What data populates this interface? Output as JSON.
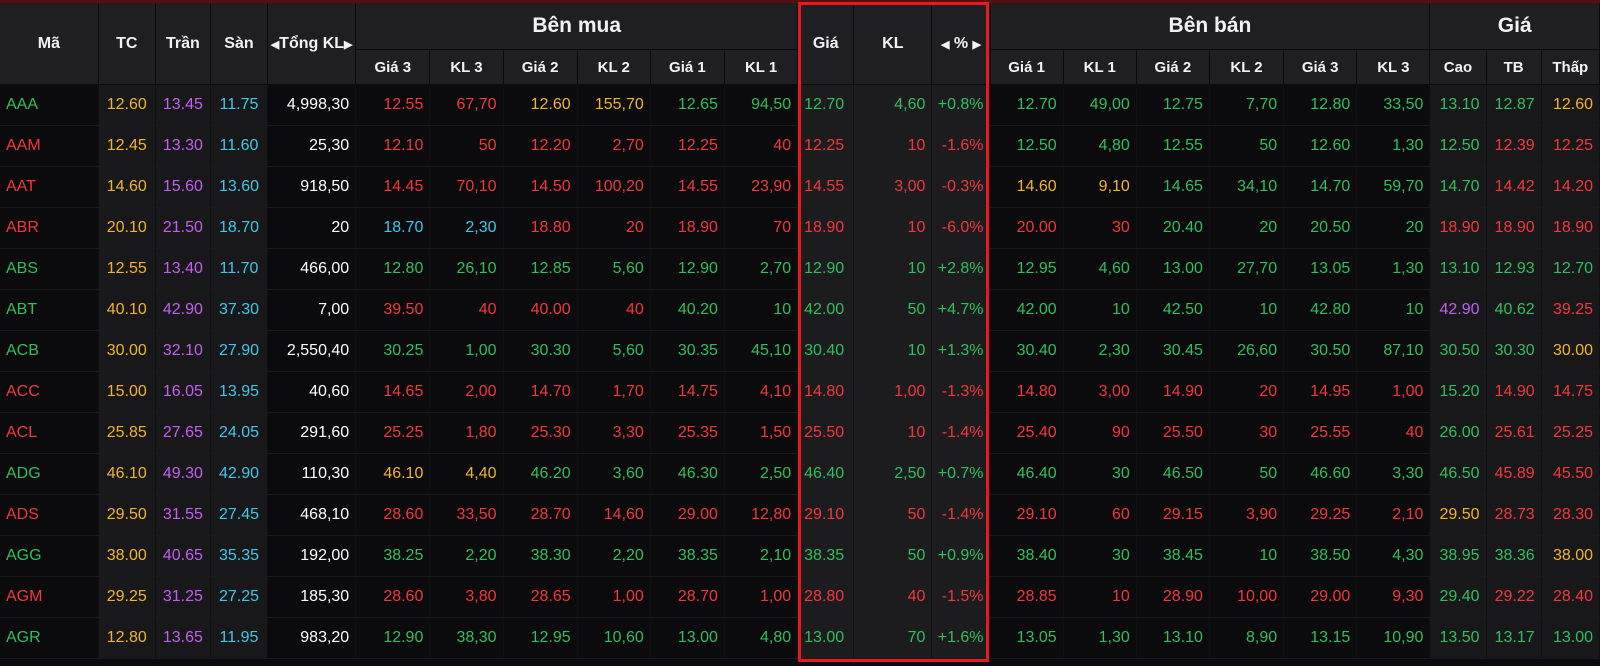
{
  "headers": {
    "symbol": "Mã",
    "ref": "TC",
    "ceiling": "Trần",
    "floor": "Sàn",
    "total_vol": "Tổng KL",
    "buy_side": "Bên mua",
    "buy_cols": [
      "Giá 3",
      "KL 3",
      "Giá 2",
      "KL 2",
      "Giá 1",
      "KL 1"
    ],
    "match_price": "Giá",
    "match_vol": "KL",
    "match_pct": "%",
    "sell_side": "Bên bán",
    "sell_cols": [
      "Giá 1",
      "KL 1",
      "Giá 2",
      "KL 2",
      "Giá 3",
      "KL 3"
    ],
    "price_group": "Giá",
    "price_cols": [
      "Cao",
      "TB",
      "Thấp"
    ]
  },
  "colors": {
    "green": "#2fbf5b",
    "red": "#f2373a",
    "yellow": "#f0b429",
    "purple": "#c45ef0",
    "cyan": "#3ec8e8",
    "highlight": "#e51a1f"
  },
  "rows": [
    {
      "s": "AAA",
      "tc": "12.60",
      "tr": "13.45",
      "sa": "11.75",
      "tkl": "4,998,30",
      "b3": "12.55",
      "bk3": "67,70",
      "b2": "12.60",
      "bk2": "155,70",
      "b1": "12.65",
      "bk1": "94,50",
      "mp": "12.70",
      "mv": "4,60",
      "pc": "+0.8%",
      "s1": "12.70",
      "sk1": "49,00",
      "s2": "12.75",
      "sk2": "7,70",
      "s3": "12.80",
      "sk3": "33,50",
      "hi": "13.10",
      "avg": "12.87",
      "lo": "12.60",
      "c": {
        "s": "green",
        "b3": "red",
        "b2": "yellow",
        "b1": "green",
        "m": "green",
        "s1": "green",
        "s2": "green",
        "s3": "green",
        "hi": "green",
        "avg": "green",
        "lo": "yellow"
      }
    },
    {
      "s": "AAM",
      "tc": "12.45",
      "tr": "13.30",
      "sa": "11.60",
      "tkl": "25,30",
      "b3": "12.10",
      "bk3": "50",
      "b2": "12.20",
      "bk2": "2,70",
      "b1": "12.25",
      "bk1": "40",
      "mp": "12.25",
      "mv": "10",
      "pc": "-1.6%",
      "s1": "12.50",
      "sk1": "4,80",
      "s2": "12.55",
      "sk2": "50",
      "s3": "12.60",
      "sk3": "1,30",
      "hi": "12.50",
      "avg": "12.39",
      "lo": "12.25",
      "c": {
        "s": "red",
        "b3": "red",
        "b2": "red",
        "b1": "red",
        "m": "red",
        "s1": "green",
        "s2": "green",
        "s3": "green",
        "hi": "green",
        "avg": "red",
        "lo": "red"
      }
    },
    {
      "s": "AAT",
      "tc": "14.60",
      "tr": "15.60",
      "sa": "13.60",
      "tkl": "918,50",
      "b3": "14.45",
      "bk3": "70,10",
      "b2": "14.50",
      "bk2": "100,20",
      "b1": "14.55",
      "bk1": "23,90",
      "mp": "14.55",
      "mv": "3,00",
      "pc": "-0.3%",
      "s1": "14.60",
      "sk1": "9,10",
      "s2": "14.65",
      "sk2": "34,10",
      "s3": "14.70",
      "sk3": "59,70",
      "hi": "14.70",
      "avg": "14.42",
      "lo": "14.20",
      "c": {
        "s": "red",
        "b3": "red",
        "b2": "red",
        "b1": "red",
        "m": "red",
        "s1": "yellow",
        "s2": "green",
        "s3": "green",
        "hi": "green",
        "avg": "red",
        "lo": "red"
      }
    },
    {
      "s": "ABR",
      "tc": "20.10",
      "tr": "21.50",
      "sa": "18.70",
      "tkl": "20",
      "b3": "18.70",
      "bk3": "2,30",
      "b2": "18.80",
      "bk2": "20",
      "b1": "18.90",
      "bk1": "70",
      "mp": "18.90",
      "mv": "10",
      "pc": "-6.0%",
      "s1": "20.00",
      "sk1": "30",
      "s2": "20.40",
      "sk2": "20",
      "s3": "20.50",
      "sk3": "20",
      "hi": "18.90",
      "avg": "18.90",
      "lo": "18.90",
      "c": {
        "s": "red",
        "b3": "cyan",
        "b2": "red",
        "b1": "red",
        "m": "red",
        "s1": "red",
        "s2": "green",
        "s3": "green",
        "hi": "red",
        "avg": "red",
        "lo": "red"
      }
    },
    {
      "s": "ABS",
      "tc": "12.55",
      "tr": "13.40",
      "sa": "11.70",
      "tkl": "466,00",
      "b3": "12.80",
      "bk3": "26,10",
      "b2": "12.85",
      "bk2": "5,60",
      "b1": "12.90",
      "bk1": "2,70",
      "mp": "12.90",
      "mv": "10",
      "pc": "+2.8%",
      "s1": "12.95",
      "sk1": "4,60",
      "s2": "13.00",
      "sk2": "27,70",
      "s3": "13.05",
      "sk3": "1,30",
      "hi": "13.10",
      "avg": "12.93",
      "lo": "12.70",
      "c": {
        "s": "green",
        "b3": "green",
        "b2": "green",
        "b1": "green",
        "m": "green",
        "s1": "green",
        "s2": "green",
        "s3": "green",
        "hi": "green",
        "avg": "green",
        "lo": "green"
      }
    },
    {
      "s": "ABT",
      "tc": "40.10",
      "tr": "42.90",
      "sa": "37.30",
      "tkl": "7,00",
      "b3": "39.50",
      "bk3": "40",
      "b2": "40.00",
      "bk2": "40",
      "b1": "40.20",
      "bk1": "10",
      "mp": "42.00",
      "mv": "50",
      "pc": "+4.7%",
      "s1": "42.00",
      "sk1": "10",
      "s2": "42.50",
      "sk2": "10",
      "s3": "42.80",
      "sk3": "10",
      "hi": "42.90",
      "avg": "40.62",
      "lo": "39.25",
      "c": {
        "s": "green",
        "b3": "red",
        "b2": "red",
        "b1": "green",
        "m": "green",
        "s1": "green",
        "s2": "green",
        "s3": "green",
        "hi": "purple",
        "avg": "green",
        "lo": "red"
      }
    },
    {
      "s": "ACB",
      "tc": "30.00",
      "tr": "32.10",
      "sa": "27.90",
      "tkl": "2,550,40",
      "b3": "30.25",
      "bk3": "1,00",
      "b2": "30.30",
      "bk2": "5,60",
      "b1": "30.35",
      "bk1": "45,10",
      "mp": "30.40",
      "mv": "10",
      "pc": "+1.3%",
      "s1": "30.40",
      "sk1": "2,30",
      "s2": "30.45",
      "sk2": "26,60",
      "s3": "30.50",
      "sk3": "87,10",
      "hi": "30.50",
      "avg": "30.30",
      "lo": "30.00",
      "c": {
        "s": "green",
        "b3": "green",
        "b2": "green",
        "b1": "green",
        "m": "green",
        "s1": "green",
        "s2": "green",
        "s3": "green",
        "hi": "green",
        "avg": "green",
        "lo": "yellow"
      }
    },
    {
      "s": "ACC",
      "tc": "15.00",
      "tr": "16.05",
      "sa": "13.95",
      "tkl": "40,60",
      "b3": "14.65",
      "bk3": "2,00",
      "b2": "14.70",
      "bk2": "1,70",
      "b1": "14.75",
      "bk1": "4,10",
      "mp": "14.80",
      "mv": "1,00",
      "pc": "-1.3%",
      "s1": "14.80",
      "sk1": "3,00",
      "s2": "14.90",
      "sk2": "20",
      "s3": "14.95",
      "sk3": "1,00",
      "hi": "15.20",
      "avg": "14.90",
      "lo": "14.75",
      "c": {
        "s": "red",
        "b3": "red",
        "b2": "red",
        "b1": "red",
        "m": "red",
        "s1": "red",
        "s2": "red",
        "s3": "red",
        "hi": "green",
        "avg": "red",
        "lo": "red"
      }
    },
    {
      "s": "ACL",
      "tc": "25.85",
      "tr": "27.65",
      "sa": "24.05",
      "tkl": "291,60",
      "b3": "25.25",
      "bk3": "1,80",
      "b2": "25.30",
      "bk2": "3,30",
      "b1": "25.35",
      "bk1": "1,50",
      "mp": "25.50",
      "mv": "10",
      "pc": "-1.4%",
      "s1": "25.40",
      "sk1": "90",
      "s2": "25.50",
      "sk2": "30",
      "s3": "25.55",
      "sk3": "40",
      "hi": "26.00",
      "avg": "25.61",
      "lo": "25.25",
      "c": {
        "s": "red",
        "b3": "red",
        "b2": "red",
        "b1": "red",
        "m": "red",
        "s1": "red",
        "s2": "red",
        "s3": "red",
        "hi": "green",
        "avg": "red",
        "lo": "red"
      }
    },
    {
      "s": "ADG",
      "tc": "46.10",
      "tr": "49.30",
      "sa": "42.90",
      "tkl": "110,30",
      "b3": "46.10",
      "bk3": "4,40",
      "b2": "46.20",
      "bk2": "3,60",
      "b1": "46.30",
      "bk1": "2,50",
      "mp": "46.40",
      "mv": "2,50",
      "pc": "+0.7%",
      "s1": "46.40",
      "sk1": "30",
      "s2": "46.50",
      "sk2": "50",
      "s3": "46.60",
      "sk3": "3,30",
      "hi": "46.50",
      "avg": "45.89",
      "lo": "45.50",
      "c": {
        "s": "green",
        "b3": "yellow",
        "b2": "green",
        "b1": "green",
        "m": "green",
        "s1": "green",
        "s2": "green",
        "s3": "green",
        "hi": "green",
        "avg": "red",
        "lo": "red"
      }
    },
    {
      "s": "ADS",
      "tc": "29.50",
      "tr": "31.55",
      "sa": "27.45",
      "tkl": "468,10",
      "b3": "28.60",
      "bk3": "33,50",
      "b2": "28.70",
      "bk2": "14,60",
      "b1": "29.00",
      "bk1": "12,80",
      "mp": "29.10",
      "mv": "50",
      "pc": "-1.4%",
      "s1": "29.10",
      "sk1": "60",
      "s2": "29.15",
      "sk2": "3,90",
      "s3": "29.25",
      "sk3": "2,10",
      "hi": "29.50",
      "avg": "28.73",
      "lo": "28.30",
      "c": {
        "s": "red",
        "b3": "red",
        "b2": "red",
        "b1": "red",
        "m": "red",
        "s1": "red",
        "s2": "red",
        "s3": "red",
        "hi": "yellow",
        "avg": "red",
        "lo": "red"
      }
    },
    {
      "s": "AGG",
      "tc": "38.00",
      "tr": "40.65",
      "sa": "35.35",
      "tkl": "192,00",
      "b3": "38.25",
      "bk3": "2,20",
      "b2": "38.30",
      "bk2": "2,20",
      "b1": "38.35",
      "bk1": "2,10",
      "mp": "38.35",
      "mv": "50",
      "pc": "+0.9%",
      "s1": "38.40",
      "sk1": "30",
      "s2": "38.45",
      "sk2": "10",
      "s3": "38.50",
      "sk3": "4,30",
      "hi": "38.95",
      "avg": "38.36",
      "lo": "38.00",
      "c": {
        "s": "green",
        "b3": "green",
        "b2": "green",
        "b1": "green",
        "m": "green",
        "s1": "green",
        "s2": "green",
        "s3": "green",
        "hi": "green",
        "avg": "green",
        "lo": "yellow"
      }
    },
    {
      "s": "AGM",
      "tc": "29.25",
      "tr": "31.25",
      "sa": "27.25",
      "tkl": "185,30",
      "b3": "28.60",
      "bk3": "3,80",
      "b2": "28.65",
      "bk2": "1,00",
      "b1": "28.70",
      "bk1": "1,00",
      "mp": "28.80",
      "mv": "40",
      "pc": "-1.5%",
      "s1": "28.85",
      "sk1": "10",
      "s2": "28.90",
      "sk2": "10,00",
      "s3": "29.00",
      "sk3": "9,30",
      "hi": "29.40",
      "avg": "29.22",
      "lo": "28.40",
      "c": {
        "s": "red",
        "b3": "red",
        "b2": "red",
        "b1": "red",
        "m": "red",
        "s1": "red",
        "s2": "red",
        "s3": "red",
        "hi": "green",
        "avg": "red",
        "lo": "red"
      }
    },
    {
      "s": "AGR",
      "tc": "12.80",
      "tr": "13.65",
      "sa": "11.95",
      "tkl": "983,20",
      "b3": "12.90",
      "bk3": "38,30",
      "b2": "12.95",
      "bk2": "10,60",
      "b1": "13.00",
      "bk1": "4,80",
      "mp": "13.00",
      "mv": "70",
      "pc": "+1.6%",
      "s1": "13.05",
      "sk1": "1,30",
      "s2": "13.10",
      "sk2": "8,90",
      "s3": "13.15",
      "sk3": "10,90",
      "hi": "13.50",
      "avg": "13.17",
      "lo": "13.00",
      "c": {
        "s": "green",
        "b3": "green",
        "b2": "green",
        "b1": "green",
        "m": "green",
        "s1": "green",
        "s2": "green",
        "s3": "green",
        "hi": "green",
        "avg": "green",
        "lo": "green"
      }
    }
  ]
}
